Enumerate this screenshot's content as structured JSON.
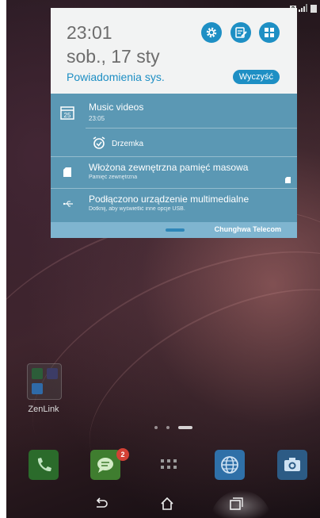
{
  "status_bar": {
    "sim_number": "2"
  },
  "shade": {
    "time": "23:01",
    "date": "sob., 17 sty",
    "system_notifications_label": "Powiadomienia sys.",
    "clear_button": "Wyczyść",
    "quick_settings": [
      "gear-icon",
      "edit-note-icon",
      "grid-apps-icon"
    ],
    "accent_color": "#1e8fc4",
    "notifications": [
      {
        "icon": "calendar-icon",
        "icon_text": "25",
        "title": "Music videos",
        "subtitle": "23:05",
        "action": {
          "icon": "alarm-clock-icon",
          "label": "Drzemka"
        }
      },
      {
        "icon": "sd-card-icon",
        "title": "Włożona zewnętrzna pamięć masowa",
        "subtitle": "Pamięć zewnętrzna"
      },
      {
        "icon": "usb-icon",
        "title": "Podłączono urządzenie multimedialne",
        "subtitle": "Dotknij, aby wyświetlić inne opcje USB."
      }
    ],
    "carrier": "Chunghwa Telecom"
  },
  "home": {
    "folder_label": "ZenLink",
    "dock_apps": [
      "phone-icon",
      "messages-icon",
      "app-drawer-icon",
      "browser-icon",
      "camera-icon"
    ],
    "messages_badge": "2"
  },
  "nav": [
    "back-icon",
    "home-icon",
    "recent-apps-icon"
  ]
}
